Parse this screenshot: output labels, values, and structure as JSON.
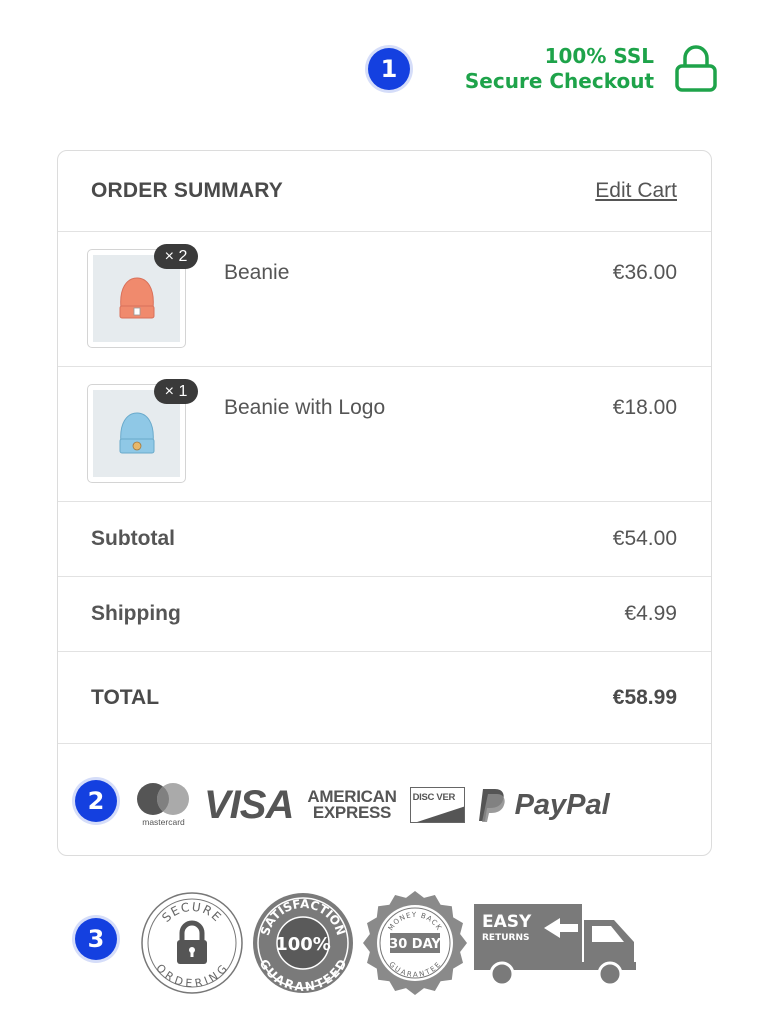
{
  "callouts": [
    "1",
    "2",
    "3"
  ],
  "ssl": {
    "line1": "100% SSL",
    "line2": "Secure Checkout",
    "color": "#1ea34a",
    "icon": "lock-icon"
  },
  "order": {
    "title": "ORDER SUMMARY",
    "edit_label": "Edit Cart",
    "items": [
      {
        "name": "Beanie",
        "quantity": "× 2",
        "price": "€36.00",
        "image": "beanie-orange",
        "color": "#f08a6d"
      },
      {
        "name": "Beanie with Logo",
        "quantity": "× 1",
        "price": "€18.00",
        "image": "beanie-blue",
        "color": "#8fc8e6"
      }
    ],
    "subtotal": {
      "label": "Subtotal",
      "value": "€54.00"
    },
    "shipping": {
      "label": "Shipping",
      "value": "€4.99"
    },
    "total": {
      "label": "TOTAL",
      "value": "€58.99"
    }
  },
  "payment_methods": {
    "mastercard": "mastercard",
    "visa": "VISA",
    "amex_line1": "AMERICAN",
    "amex_line2": "EXPRESS",
    "discover": "DISC VER",
    "paypal": "PayPal"
  },
  "trust_badges": {
    "secure_top": "SECURE",
    "secure_bottom": "ORDERING",
    "satisfaction_top": "SATISFACTION",
    "satisfaction_mid": "100%",
    "satisfaction_bottom": "GUARANTEED",
    "moneyback_top": "MONEY BACK",
    "moneyback_mid": "30 DAY",
    "moneyback_bottom": "GUARANTEE",
    "returns_line1": "EASY",
    "returns_line2": "RETURNS"
  },
  "colors": {
    "accent": "#1440e0",
    "text": "#555555",
    "border": "#dcdcdc",
    "badge_gray": "#7a7a7a"
  }
}
